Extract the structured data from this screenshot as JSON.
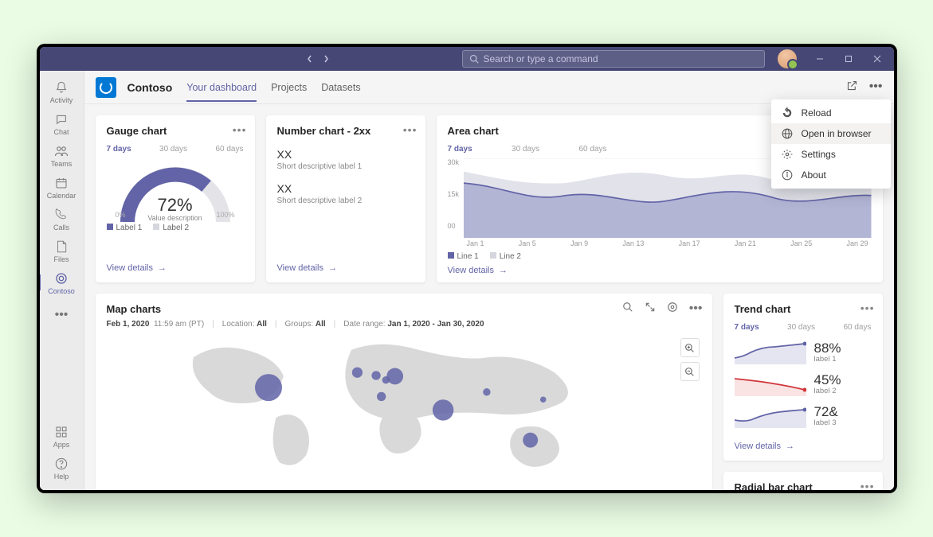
{
  "titlebar": {
    "search_placeholder": "Search or type a command"
  },
  "rail": {
    "items": [
      {
        "label": "Activity"
      },
      {
        "label": "Chat"
      },
      {
        "label": "Teams"
      },
      {
        "label": "Calendar"
      },
      {
        "label": "Calls"
      },
      {
        "label": "Files"
      },
      {
        "label": "Contoso"
      }
    ],
    "bottom": [
      {
        "label": "Apps"
      },
      {
        "label": "Help"
      }
    ]
  },
  "header": {
    "app_name": "Contoso",
    "tabs": [
      "Your dashboard",
      "Projects",
      "Datasets"
    ]
  },
  "dropdown": {
    "items": [
      "Reload",
      "Open in browser",
      "Settings",
      "About"
    ]
  },
  "gauge": {
    "title": "Gauge chart",
    "ranges": [
      "7 days",
      "30 days",
      "60 days"
    ],
    "value": "72%",
    "value_desc": "Value description",
    "scale_min": "0%",
    "scale_max": "100%",
    "legend": [
      "Label 1",
      "Label 2"
    ],
    "view_details": "View details"
  },
  "number": {
    "title": "Number chart - 2xx",
    "items": [
      {
        "val": "XX",
        "desc": "Short descriptive label 1"
      },
      {
        "val": "XX",
        "desc": "Short descriptive label 2"
      }
    ],
    "view_details": "View details"
  },
  "area": {
    "title": "Area chart",
    "ranges": [
      "7 days",
      "30 days",
      "60 days"
    ],
    "y_ticks": [
      "30k",
      "15k",
      "00"
    ],
    "x_ticks": [
      "Jan 1",
      "Jan 5",
      "Jan 9",
      "Jan 13",
      "Jan 17",
      "Jan 21",
      "Jan 25",
      "Jan 29"
    ],
    "legend": [
      "Line 1",
      "Line 2"
    ],
    "view_details": "View details"
  },
  "map": {
    "title": "Map charts",
    "date": "Feb 1, 2020",
    "time": "11:59 am (PT)",
    "location_label": "Location:",
    "location_val": "All",
    "groups_label": "Groups:",
    "groups_val": "All",
    "range_label": "Date range:",
    "range_val": "Jan 1, 2020 - Jan 30, 2020"
  },
  "trend": {
    "title": "Trend chart",
    "ranges": [
      "7 days",
      "30 days",
      "60 days"
    ],
    "rows": [
      {
        "val": "88%",
        "label": "label 1"
      },
      {
        "val": "45%",
        "label": "label 2"
      },
      {
        "val": "72&",
        "label": "label 3"
      }
    ],
    "view_details": "View details"
  },
  "radial": {
    "title": "Radial bar chart"
  },
  "chart_data": [
    {
      "type": "gauge",
      "title": "Gauge chart",
      "value": 72,
      "min": 0,
      "max": 100,
      "unit": "%",
      "label": "Value description",
      "legend": [
        "Label 1",
        "Label 2"
      ]
    },
    {
      "type": "area",
      "title": "Area chart",
      "x": [
        "Jan 1",
        "Jan 5",
        "Jan 9",
        "Jan 13",
        "Jan 17",
        "Jan 21",
        "Jan 25",
        "Jan 29"
      ],
      "series": [
        {
          "name": "Line 1",
          "values": [
            21000,
            20000,
            15000,
            18000,
            15000,
            19000,
            16000,
            17000
          ]
        },
        {
          "name": "Line 2",
          "values": [
            26000,
            23000,
            21000,
            26000,
            22000,
            27000,
            22000,
            25000
          ]
        }
      ],
      "ylim": [
        0,
        30000
      ],
      "y_ticks": [
        0,
        15000,
        30000
      ]
    },
    {
      "type": "bubble-map",
      "title": "Map charts",
      "date_range": "Jan 1, 2020 - Jan 30, 2020",
      "points_approx_pct_xy_size": [
        [
          22,
          38,
          18
        ],
        [
          40,
          28,
          7
        ],
        [
          44,
          30,
          6
        ],
        [
          46,
          33,
          5
        ],
        [
          48,
          30,
          10
        ],
        [
          45,
          46,
          6
        ],
        [
          58,
          55,
          14
        ],
        [
          67,
          42,
          5
        ],
        [
          79,
          48,
          4
        ],
        [
          76,
          78,
          10
        ]
      ]
    },
    {
      "type": "sparkline-group",
      "title": "Trend chart",
      "series": [
        {
          "name": "label 1",
          "value": "88%",
          "color": "#6264a7",
          "values": [
            30,
            32,
            40,
            44,
            50,
            60,
            70,
            72,
            75,
            80,
            82,
            85,
            86,
            88
          ]
        },
        {
          "name": "label 2",
          "value": "45%",
          "color": "#d13438",
          "values": [
            60,
            58,
            55,
            54,
            52,
            50,
            49,
            48,
            47,
            46,
            46,
            45,
            45,
            44
          ]
        },
        {
          "name": "label 3",
          "value": "72&",
          "color": "#6264a7",
          "values": [
            40,
            42,
            38,
            45,
            50,
            55,
            58,
            63,
            65,
            68,
            70,
            71,
            72,
            72
          ]
        }
      ]
    }
  ]
}
